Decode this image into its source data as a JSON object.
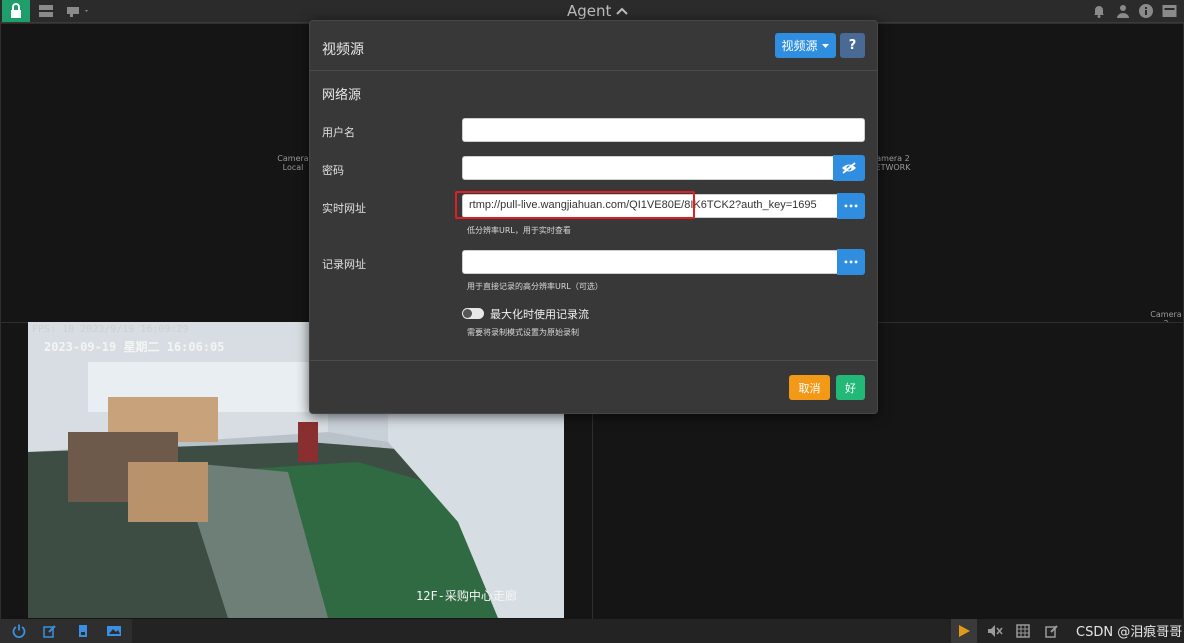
{
  "topbar": {
    "title": "Agent",
    "icons": [
      "lock-icon",
      "server-icon",
      "camera-icon",
      "bell-icon",
      "user-icon",
      "info-icon",
      "window-icon"
    ]
  },
  "grid": {
    "camera1_label": "Camera",
    "camera1_sublabel": "Local",
    "camera2_label": "amera 2",
    "camera2_sublabel": "ETWORK",
    "camera2_corner_label": "Camera 2"
  },
  "video": {
    "fps_text": "FPS: 10 2023/9/19 16:09:29",
    "timestamp": "2023-09-19 星期二 16:06:05",
    "location": "12F-采购中心走廊"
  },
  "dialog": {
    "title": "视频源",
    "source_button": "视频源",
    "help_button": "?",
    "section": "网络源",
    "username_label": "用户名",
    "username_value": "",
    "password_label": "密码",
    "password_value": "",
    "live_url_label": "实时网址",
    "live_url_value": "rtmp://pull-live.wangjiahuan.com/QI1VE80E/8IK6TCK2?auth_key=1695",
    "live_url_hint": "低分辨率URL，用于实时查看",
    "record_url_label": "记录网址",
    "record_url_value": "",
    "record_url_hint": "用于直接记录的高分辨率URL（可选）",
    "toggle_label": "最大化时使用记录流",
    "toggle_on": false,
    "toggle_hint": "需要将录制模式设置为原始录制",
    "cancel_button": "取消",
    "ok_button": "好",
    "more_glyph": "•••"
  },
  "bottombar": {
    "icons": [
      "power-icon",
      "edit-icon",
      "document-icon",
      "image-icon",
      "play-icon",
      "mute-icon",
      "grid-icon",
      "edit-icon",
      "link-icon",
      "settings-icon"
    ]
  },
  "watermark": "CSDN @泪痕哥哥",
  "colors": {
    "accent": "#2f8ee0",
    "success": "#22b878",
    "warning": "#f29a18",
    "highlight": "#e02020"
  }
}
